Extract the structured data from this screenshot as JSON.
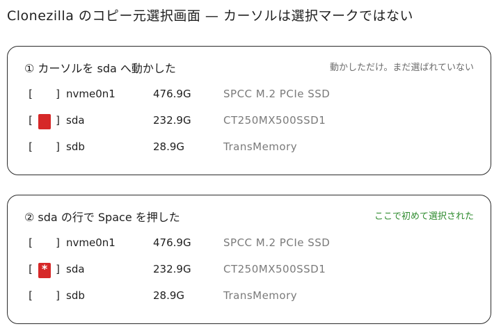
{
  "title": "Clonezilla のコピー元選択画面 — カーソルは選択マークではない",
  "panels": [
    {
      "heading": "① カーソルを sda へ動かした",
      "note": "動かしただけ。まだ選ばれていない",
      "rows": [
        {
          "open": "[",
          "close": "]",
          "marker": "none",
          "device": "nvme0n1",
          "size": "476.9G",
          "model": "SPCC M.2 PCIe SSD"
        },
        {
          "open": "[",
          "close": "]",
          "marker": "cursor",
          "device": "sda",
          "size": "232.9G",
          "model": "CT250MX500SSD1"
        },
        {
          "open": "[",
          "close": "]",
          "marker": "none",
          "device": "sdb",
          "size": "28.9G",
          "model": "TransMemory"
        }
      ]
    },
    {
      "heading": "② sda の行で Space を押した",
      "note": "ここで初めて選択された",
      "rows": [
        {
          "open": "[",
          "close": "]",
          "marker": "none",
          "device": "nvme0n1",
          "size": "476.9G",
          "model": "SPCC M.2 PCIe SSD"
        },
        {
          "open": "[",
          "close": "]",
          "marker": "selected",
          "device": "sda",
          "size": "232.9G",
          "model": "CT250MX500SSD1"
        },
        {
          "open": "[",
          "close": "]",
          "marker": "none",
          "device": "sdb",
          "size": "28.9G",
          "model": "TransMemory"
        }
      ]
    }
  ],
  "colors": {
    "cursor": "#d62828",
    "note_gray": "#6b6b6b",
    "note_green": "#2e8b2e"
  }
}
